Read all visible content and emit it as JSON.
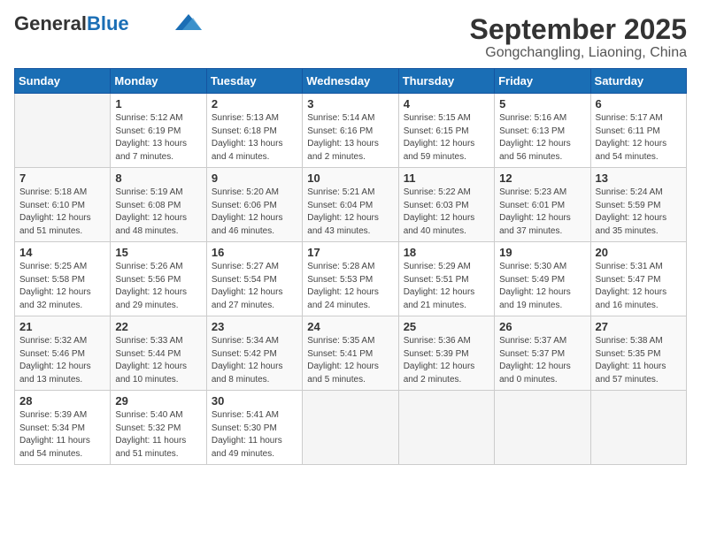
{
  "header": {
    "logo_general": "General",
    "logo_blue": "Blue",
    "month": "September 2025",
    "location": "Gongchangling, Liaoning, China"
  },
  "weekdays": [
    "Sunday",
    "Monday",
    "Tuesday",
    "Wednesday",
    "Thursday",
    "Friday",
    "Saturday"
  ],
  "weeks": [
    [
      {
        "day": "",
        "info": ""
      },
      {
        "day": "1",
        "info": "Sunrise: 5:12 AM\nSunset: 6:19 PM\nDaylight: 13 hours\nand 7 minutes."
      },
      {
        "day": "2",
        "info": "Sunrise: 5:13 AM\nSunset: 6:18 PM\nDaylight: 13 hours\nand 4 minutes."
      },
      {
        "day": "3",
        "info": "Sunrise: 5:14 AM\nSunset: 6:16 PM\nDaylight: 13 hours\nand 2 minutes."
      },
      {
        "day": "4",
        "info": "Sunrise: 5:15 AM\nSunset: 6:15 PM\nDaylight: 12 hours\nand 59 minutes."
      },
      {
        "day": "5",
        "info": "Sunrise: 5:16 AM\nSunset: 6:13 PM\nDaylight: 12 hours\nand 56 minutes."
      },
      {
        "day": "6",
        "info": "Sunrise: 5:17 AM\nSunset: 6:11 PM\nDaylight: 12 hours\nand 54 minutes."
      }
    ],
    [
      {
        "day": "7",
        "info": "Sunrise: 5:18 AM\nSunset: 6:10 PM\nDaylight: 12 hours\nand 51 minutes."
      },
      {
        "day": "8",
        "info": "Sunrise: 5:19 AM\nSunset: 6:08 PM\nDaylight: 12 hours\nand 48 minutes."
      },
      {
        "day": "9",
        "info": "Sunrise: 5:20 AM\nSunset: 6:06 PM\nDaylight: 12 hours\nand 46 minutes."
      },
      {
        "day": "10",
        "info": "Sunrise: 5:21 AM\nSunset: 6:04 PM\nDaylight: 12 hours\nand 43 minutes."
      },
      {
        "day": "11",
        "info": "Sunrise: 5:22 AM\nSunset: 6:03 PM\nDaylight: 12 hours\nand 40 minutes."
      },
      {
        "day": "12",
        "info": "Sunrise: 5:23 AM\nSunset: 6:01 PM\nDaylight: 12 hours\nand 37 minutes."
      },
      {
        "day": "13",
        "info": "Sunrise: 5:24 AM\nSunset: 5:59 PM\nDaylight: 12 hours\nand 35 minutes."
      }
    ],
    [
      {
        "day": "14",
        "info": "Sunrise: 5:25 AM\nSunset: 5:58 PM\nDaylight: 12 hours\nand 32 minutes."
      },
      {
        "day": "15",
        "info": "Sunrise: 5:26 AM\nSunset: 5:56 PM\nDaylight: 12 hours\nand 29 minutes."
      },
      {
        "day": "16",
        "info": "Sunrise: 5:27 AM\nSunset: 5:54 PM\nDaylight: 12 hours\nand 27 minutes."
      },
      {
        "day": "17",
        "info": "Sunrise: 5:28 AM\nSunset: 5:53 PM\nDaylight: 12 hours\nand 24 minutes."
      },
      {
        "day": "18",
        "info": "Sunrise: 5:29 AM\nSunset: 5:51 PM\nDaylight: 12 hours\nand 21 minutes."
      },
      {
        "day": "19",
        "info": "Sunrise: 5:30 AM\nSunset: 5:49 PM\nDaylight: 12 hours\nand 19 minutes."
      },
      {
        "day": "20",
        "info": "Sunrise: 5:31 AM\nSunset: 5:47 PM\nDaylight: 12 hours\nand 16 minutes."
      }
    ],
    [
      {
        "day": "21",
        "info": "Sunrise: 5:32 AM\nSunset: 5:46 PM\nDaylight: 12 hours\nand 13 minutes."
      },
      {
        "day": "22",
        "info": "Sunrise: 5:33 AM\nSunset: 5:44 PM\nDaylight: 12 hours\nand 10 minutes."
      },
      {
        "day": "23",
        "info": "Sunrise: 5:34 AM\nSunset: 5:42 PM\nDaylight: 12 hours\nand 8 minutes."
      },
      {
        "day": "24",
        "info": "Sunrise: 5:35 AM\nSunset: 5:41 PM\nDaylight: 12 hours\nand 5 minutes."
      },
      {
        "day": "25",
        "info": "Sunrise: 5:36 AM\nSunset: 5:39 PM\nDaylight: 12 hours\nand 2 minutes."
      },
      {
        "day": "26",
        "info": "Sunrise: 5:37 AM\nSunset: 5:37 PM\nDaylight: 12 hours\nand 0 minutes."
      },
      {
        "day": "27",
        "info": "Sunrise: 5:38 AM\nSunset: 5:35 PM\nDaylight: 11 hours\nand 57 minutes."
      }
    ],
    [
      {
        "day": "28",
        "info": "Sunrise: 5:39 AM\nSunset: 5:34 PM\nDaylight: 11 hours\nand 54 minutes."
      },
      {
        "day": "29",
        "info": "Sunrise: 5:40 AM\nSunset: 5:32 PM\nDaylight: 11 hours\nand 51 minutes."
      },
      {
        "day": "30",
        "info": "Sunrise: 5:41 AM\nSunset: 5:30 PM\nDaylight: 11 hours\nand 49 minutes."
      },
      {
        "day": "",
        "info": ""
      },
      {
        "day": "",
        "info": ""
      },
      {
        "day": "",
        "info": ""
      },
      {
        "day": "",
        "info": ""
      }
    ]
  ]
}
